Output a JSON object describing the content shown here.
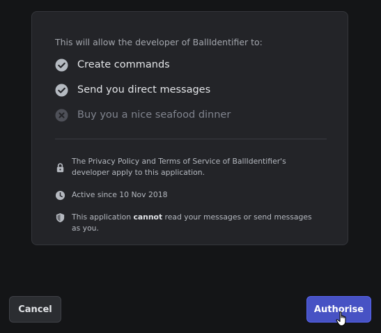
{
  "intro": "This will allow the developer of BallIdentifier to:",
  "permissions": [
    {
      "label": "Create commands",
      "granted": true
    },
    {
      "label": "Send you direct messages",
      "granted": true
    },
    {
      "label": "Buy you a nice seafood dinner",
      "granted": false
    }
  ],
  "info": {
    "privacy": "The Privacy Policy and Terms of Service of BallIdentifier's developer apply to this application.",
    "active_since": "Active since 10 Nov 2018",
    "security_prefix": "This application ",
    "security_bold": "cannot",
    "security_suffix": " read your messages or send messages as you."
  },
  "buttons": {
    "cancel": "Cancel",
    "authorise": "Authorise"
  },
  "colors": {
    "accent": "#4752c4",
    "granted_icon": "#b5bac1",
    "denied_icon": "#4e5058"
  },
  "icons": {
    "granted": "check-circle-icon",
    "denied": "x-circle-icon",
    "privacy": "lock-icon",
    "active": "clock-icon",
    "security": "shield-icon",
    "pointer": "hand-pointer-cursor"
  }
}
